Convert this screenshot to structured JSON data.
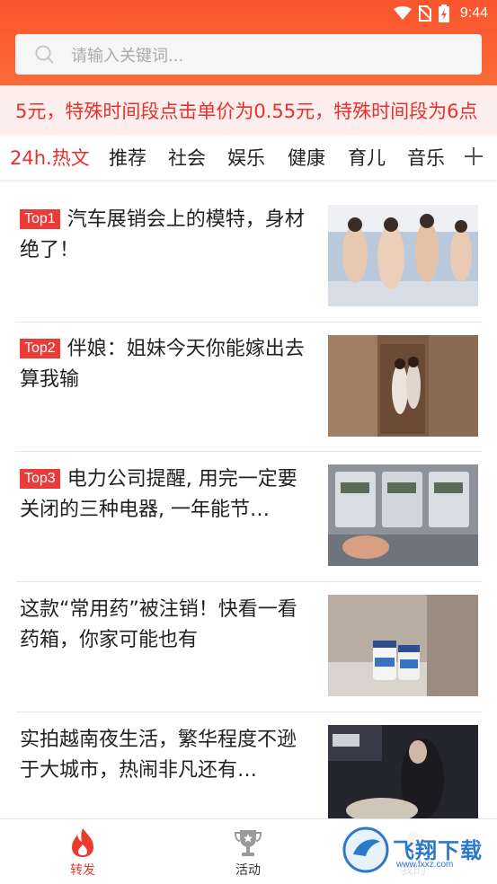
{
  "status_bar": {
    "time": "9:44"
  },
  "search": {
    "placeholder": "请输入关键词..."
  },
  "notice": {
    "text": "5元，特殊时间段点击单价为0.55元，特殊时间段为6点"
  },
  "tabs": [
    {
      "label": "24h.热文",
      "active": true
    },
    {
      "label": "推荐",
      "active": false
    },
    {
      "label": "社会",
      "active": false
    },
    {
      "label": "娱乐",
      "active": false
    },
    {
      "label": "健康",
      "active": false
    },
    {
      "label": "育儿",
      "active": false
    },
    {
      "label": "音乐",
      "active": false
    }
  ],
  "news": [
    {
      "badge": "Top1",
      "title": "汽车展销会上的模特，身材绝了！"
    },
    {
      "badge": "Top2",
      "title": "伴娘：姐妹今天你能嫁出去算我输"
    },
    {
      "badge": "Top3",
      "title": "电力公司提醒, 用完一定要关闭的三种电器, 一年能节…"
    },
    {
      "badge": "",
      "title": "这款“常用药”被注销！快看一看药箱，你家可能也有"
    },
    {
      "badge": "",
      "title": "实拍越南夜生活，繁华程度不逊于大城市，热闹非凡还有…"
    }
  ],
  "bottom_nav": {
    "items": [
      {
        "label": "转发",
        "icon": "flame-icon",
        "active": true
      },
      {
        "label": "活动",
        "icon": "trophy-icon",
        "active": false
      },
      {
        "label": "我的",
        "icon": "user-icon",
        "active": false
      }
    ]
  },
  "watermark": {
    "text": "飞翔下载",
    "url": "www.fxxz.com"
  },
  "colors": {
    "header": "#f9552e",
    "accent": "#ea2e2d",
    "notice_bg": "#fdeeee",
    "badge": "#ea3b3b"
  }
}
